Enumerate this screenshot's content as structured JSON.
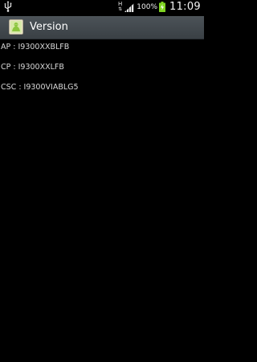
{
  "status_bar": {
    "network_type": "H",
    "battery_percent": "100%",
    "time": "11:09",
    "icons": [
      "usb-icon",
      "network-arrows-icon",
      "signal-icon",
      "battery-charging-icon"
    ]
  },
  "action_bar": {
    "title": "Version",
    "icon": "android-app-icon"
  },
  "versions": [
    {
      "text": "AP : I9300XXBLFB"
    },
    {
      "text": "CP : I9300XXLFB"
    },
    {
      "text": "CSC : I9300VIABLG5"
    }
  ],
  "colors": {
    "background": "#000000",
    "action_bar": "#434a4f",
    "text": "#d8d8d8",
    "battery": "#7ed321"
  }
}
